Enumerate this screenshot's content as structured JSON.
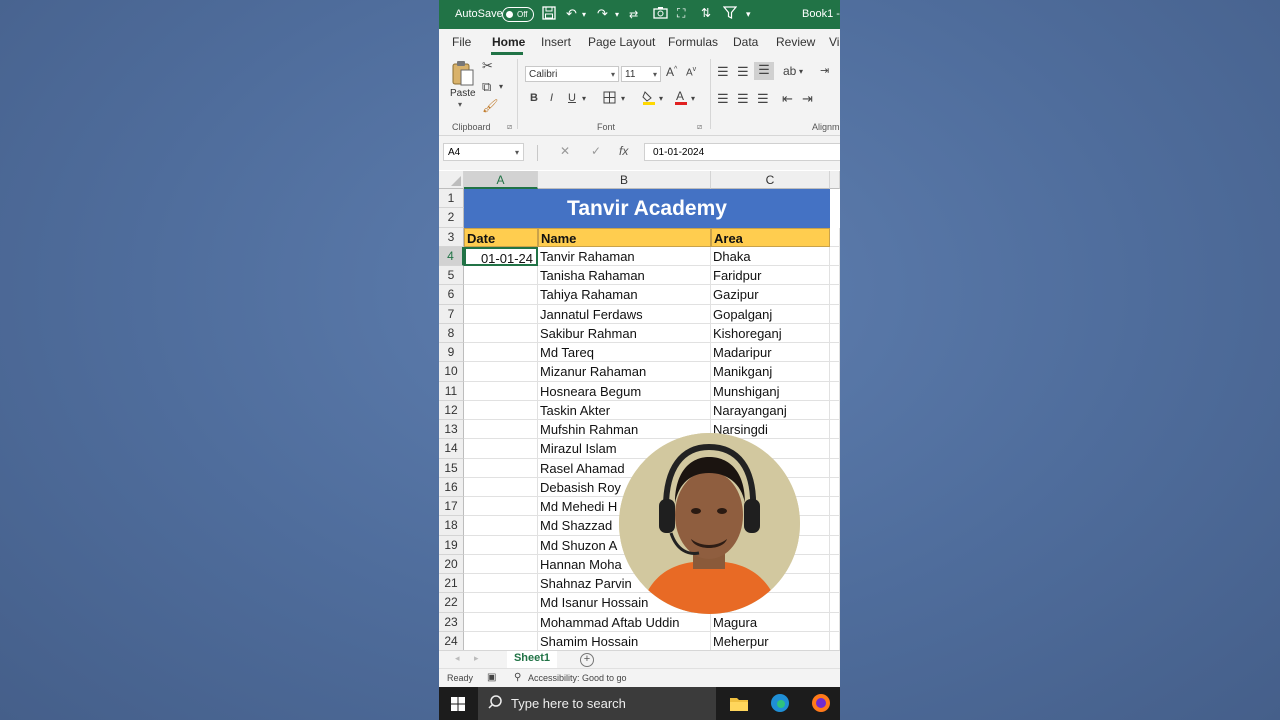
{
  "titlebar": {
    "autosave_label": "AutoSave",
    "autosave_state": "Off",
    "workbook": "Book1 -"
  },
  "tabs": [
    "File",
    "Home",
    "Insert",
    "Page Layout",
    "Formulas",
    "Data",
    "Review",
    "Vi"
  ],
  "active_tab": "Home",
  "ribbon": {
    "paste_label": "Paste",
    "clipboard_label": "Clipboard",
    "font_name": "Calibri",
    "font_size": "11",
    "font_label": "Font",
    "alignment_label": "Alignm"
  },
  "formula_bar": {
    "name_box": "A4",
    "value": "01-01-2024"
  },
  "columns": [
    "A",
    "B",
    "C"
  ],
  "sheet": {
    "banner": "Tanvir Academy",
    "headers": [
      "Date",
      "Name",
      "Area"
    ],
    "rows": [
      {
        "date": "01-01-24",
        "name": "Tanvir Rahaman",
        "area": "Dhaka"
      },
      {
        "date": "",
        "name": "Tanisha Rahaman",
        "area": "Faridpur"
      },
      {
        "date": "",
        "name": "Tahiya Rahaman",
        "area": "Gazipur"
      },
      {
        "date": "",
        "name": "Jannatul Ferdaws",
        "area": "Gopalganj"
      },
      {
        "date": "",
        "name": "Sakibur Rahman",
        "area": "Kishoreganj"
      },
      {
        "date": "",
        "name": "Md Tareq",
        "area": "Madaripur"
      },
      {
        "date": "",
        "name": "Mizanur Rahaman",
        "area": "Manikganj"
      },
      {
        "date": "",
        "name": "Hosneara Begum",
        "area": "Munshiganj"
      },
      {
        "date": "",
        "name": "Taskin Akter",
        "area": "Narayanganj"
      },
      {
        "date": "",
        "name": "Mufshin Rahman",
        "area": "Narsingdi"
      },
      {
        "date": "",
        "name": "Mirazul Islam",
        "area": ""
      },
      {
        "date": "",
        "name": "Rasel Ahamad",
        "area": ""
      },
      {
        "date": "",
        "name": "Debasish Roy",
        "area": ""
      },
      {
        "date": "",
        "name": "Md Mehedi H",
        "area": ""
      },
      {
        "date": "",
        "name": "Md Shazzad",
        "area": ""
      },
      {
        "date": "",
        "name": "Md Shuzon A",
        "area": ""
      },
      {
        "date": "",
        "name": "Hannan Moha",
        "area": ""
      },
      {
        "date": "",
        "name": "Shahnaz Parvin",
        "area": ""
      },
      {
        "date": "",
        "name": "Md Isanur Hossain",
        "area": "htia"
      },
      {
        "date": "",
        "name": "Mohammad Aftab Uddin",
        "area": "Magura"
      },
      {
        "date": "",
        "name": "Shamim Hossain",
        "area": "Meherpur"
      }
    ]
  },
  "sheet_tab": "Sheet1",
  "status": {
    "ready": "Ready",
    "accessibility": "Accessibility: Good to go"
  },
  "taskbar": {
    "search_placeholder": "Type here to search"
  },
  "colors": {
    "excel_green": "#217346",
    "banner_blue": "#4472c4",
    "header_yellow": "#ffcd4f"
  }
}
